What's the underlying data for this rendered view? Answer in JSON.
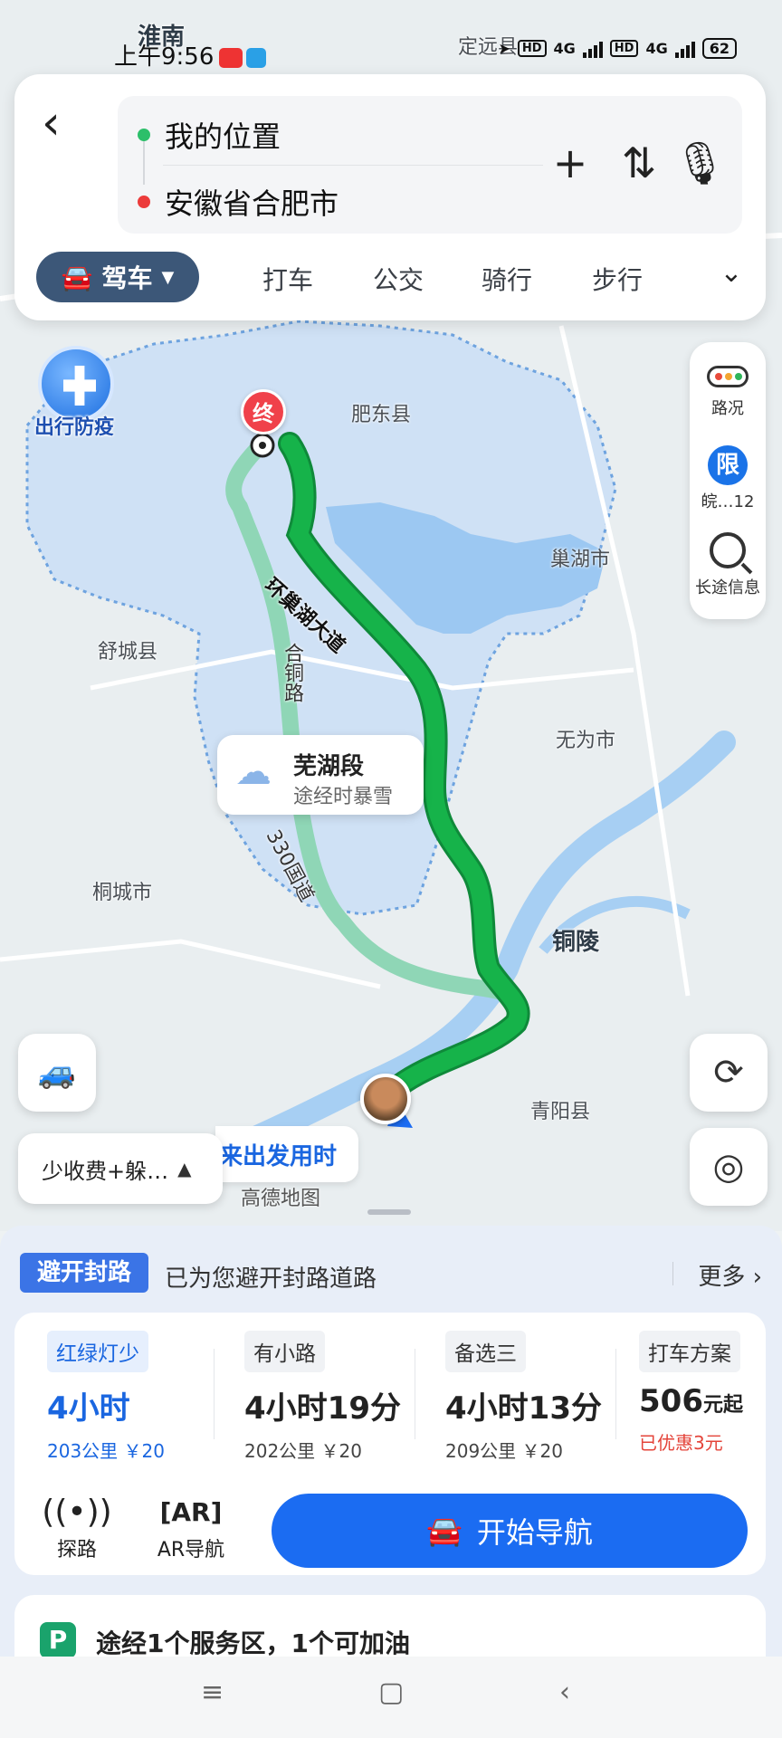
{
  "status_bar": {
    "time": "上午9:56",
    "battery": "62",
    "signal1": "4G",
    "signal2": "4G",
    "hd": "HD"
  },
  "search": {
    "from": "我的位置",
    "to": "安徽省合肥市"
  },
  "modes": {
    "active": "驾车",
    "tabs": [
      "打车",
      "公交",
      "骑行",
      "步行"
    ]
  },
  "map": {
    "labels": {
      "huainan": "淮南",
      "dingyuan": "定远县",
      "feidong": "肥东县",
      "chaohu": "巢湖市",
      "shucheng": "舒城县",
      "wuwei": "无为市",
      "tongcheng": "桐城市",
      "tongling": "铜陵",
      "qingyang": "青阳县",
      "road_huanchao": "环巢湖大道",
      "road_hetong": "合铜路",
      "road_g330": "330国道"
    },
    "end_marker": "终",
    "epidemic_badge": "出行防疫",
    "weather": {
      "title": "芜湖段",
      "desc": "途经时暴雪"
    },
    "future_time": "来出发用时",
    "logo": "高德地图"
  },
  "right_tools": {
    "traffic": "路况",
    "limit_icon": "限",
    "limit": "皖…12",
    "long_trip": "长途信息"
  },
  "preference": "少收费+躲…",
  "closure": {
    "tag": "避开封路",
    "text": "已为您避开封路道路",
    "more": "更多"
  },
  "routes": [
    {
      "tag": "红绿灯少",
      "time": "4小时",
      "meta": "203公里 ￥20",
      "active": true
    },
    {
      "tag": "有小路",
      "time": "4小时19分",
      "meta": "202公里 ￥20"
    },
    {
      "tag": "备选三",
      "time": "4小时13分",
      "meta": "209公里 ￥20"
    }
  ],
  "taxi": {
    "tag": "打车方案",
    "price": "506",
    "unit": "元起",
    "discount": "已优惠3元"
  },
  "actions": {
    "probe": "探路",
    "ar": "AR导航",
    "start": "开始导航"
  },
  "service": "途经1个服务区，1个可加油",
  "colors": {
    "route_main": "#16b34a",
    "route_alt": "#8fd6b6",
    "accent": "#1b6cf2",
    "drive_tab": "#3c5778",
    "water": "#a7cff3",
    "region": "#c8ddf3"
  }
}
